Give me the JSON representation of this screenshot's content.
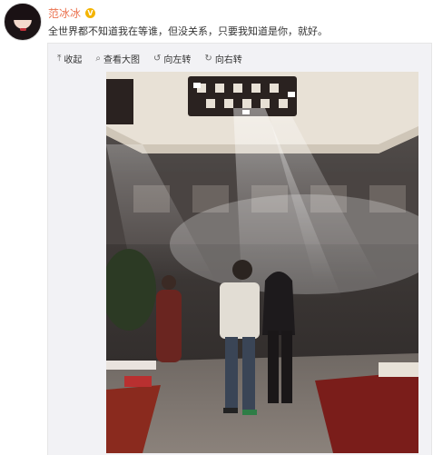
{
  "user": {
    "name": "范冰冰",
    "verified_mark": "V"
  },
  "post": {
    "text": "全世界都不知道我在等谁，但没关系，只要我知道是你，就好。"
  },
  "toolbar": {
    "collapse_label": "收起",
    "view_large_label": "查看大图",
    "rotate_left_label": "向左转",
    "rotate_right_label": "向右转",
    "collapse_icon": "arrow-up-icon",
    "view_large_icon": "magnifier-icon",
    "rotate_left_icon": "rotate-left-icon",
    "rotate_right_icon": "rotate-right-icon"
  },
  "colors": {
    "username": "#eb7350",
    "verified": "#f4b400",
    "panel_bg": "#f2f2f5"
  }
}
